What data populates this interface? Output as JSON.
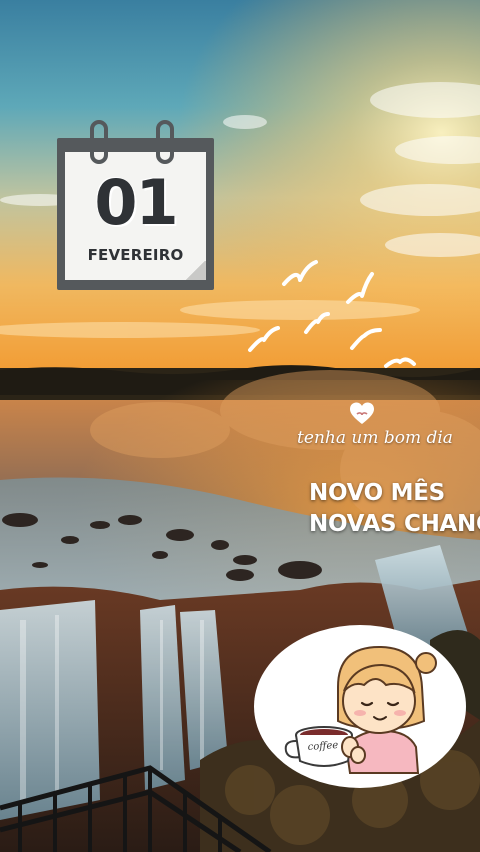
{
  "calendar": {
    "day": "01",
    "month": "FEVEREIRO"
  },
  "message": {
    "greeting": "tenha um bom dia",
    "headline_line1": "NOVO MÊS",
    "headline_line2": "NOVAS CHANCES"
  },
  "sticker": {
    "mug_label": "coffee"
  },
  "colors": {
    "calendar_frame": "#55595c",
    "calendar_page": "#f4f4f2",
    "text_light": "#ffffff",
    "sky_top": "#3a7fa0",
    "sunset": "#f2a23a"
  },
  "icons": [
    "heart-icon",
    "bird-icon",
    "calendar-icon",
    "coffee-mug-icon"
  ]
}
